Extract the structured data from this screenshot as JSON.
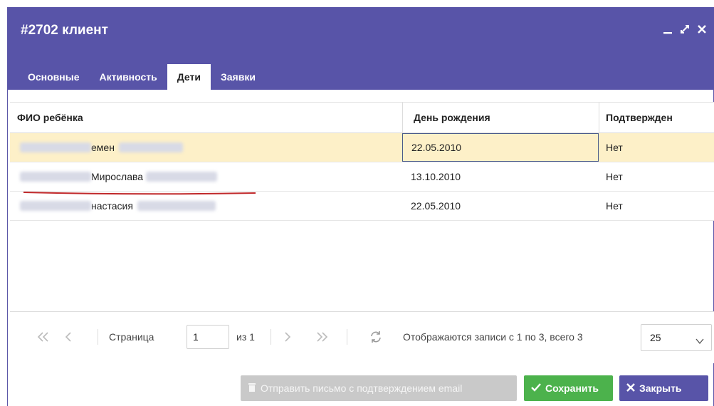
{
  "window": {
    "title": "#2702 клиент"
  },
  "tabs": [
    {
      "label": "Основные"
    },
    {
      "label": "Активность"
    },
    {
      "label": "Дети"
    },
    {
      "label": "Заявки"
    }
  ],
  "grid": {
    "columns": [
      "ФИО ребёнка",
      "День рождения",
      "Подтвержден"
    ],
    "rows": [
      {
        "name_visible": "емен",
        "birthday": "22.05.2010",
        "confirmed": "Нет"
      },
      {
        "name_visible": "Мирослава",
        "birthday": "13.10.2010",
        "confirmed": "Нет"
      },
      {
        "name_visible": "настасия",
        "birthday": "22.05.2010",
        "confirmed": "Нет"
      }
    ]
  },
  "pager": {
    "page_label": "Страница",
    "page_value": "1",
    "of_label": "из 1",
    "records_label": "Отображаются записи с 1 по 3, всего 3",
    "page_size": "25"
  },
  "footer": {
    "email_button": "Отправить письмо с подтверждением email",
    "save_button": "Сохранить",
    "close_button": "Закрыть"
  },
  "colors": {
    "header": "#5854a8",
    "selected_row": "#fdf0c8",
    "save": "#4cb24c",
    "disabled": "#c9c9c9",
    "annotation_underline": "#c0282a"
  },
  "icons": {
    "minimize": "minimize-icon",
    "maximize": "maximize-icon",
    "close": "close-icon",
    "first": "first-page-icon",
    "prev": "prev-page-icon",
    "next": "next-page-icon",
    "last": "last-page-icon",
    "refresh": "refresh-icon",
    "dropdown": "chevron-down-icon",
    "trash": "trash-icon",
    "check": "check-icon",
    "x": "x-icon"
  }
}
